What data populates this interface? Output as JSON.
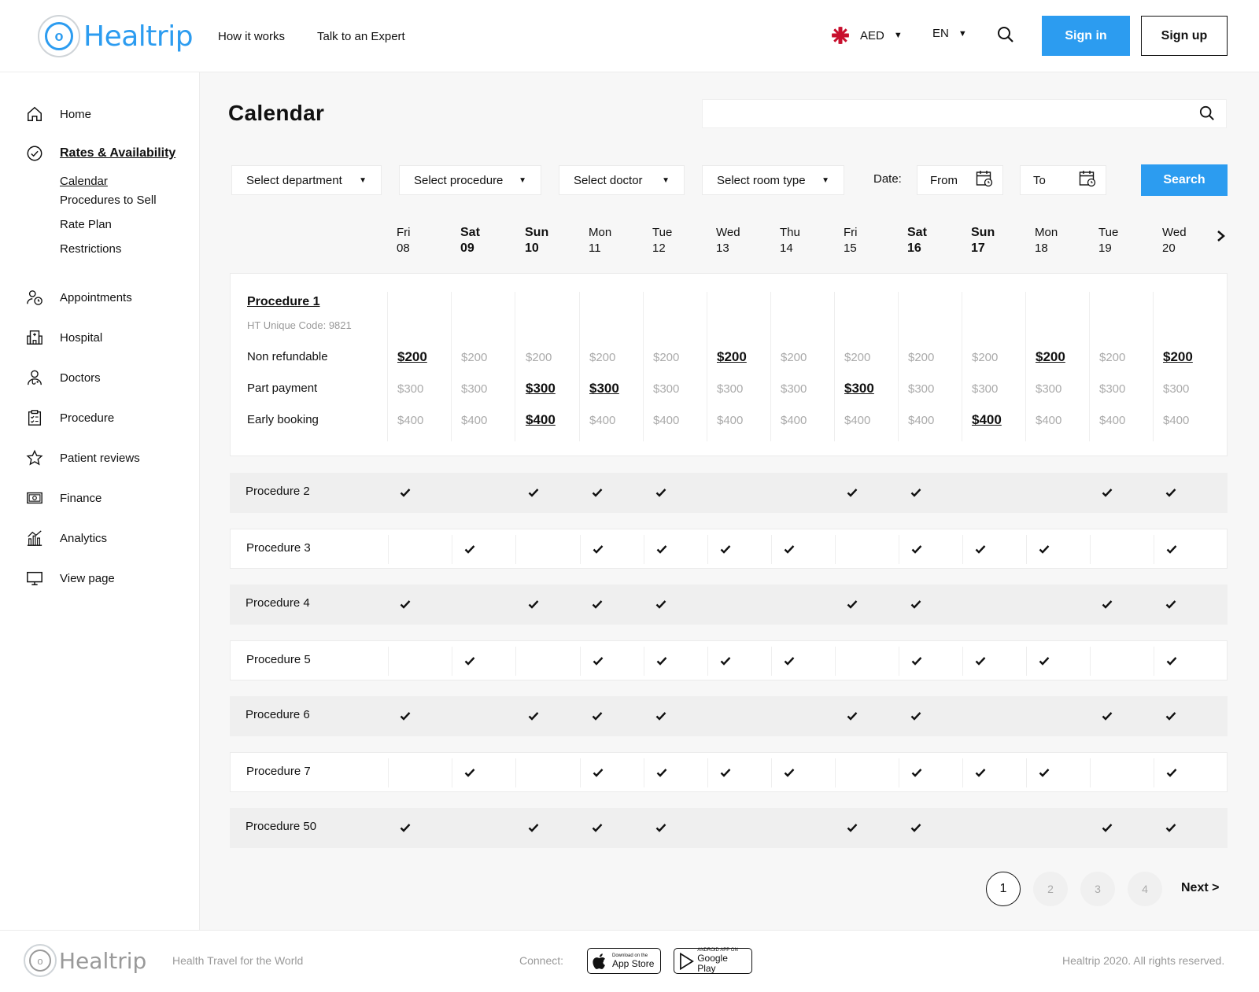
{
  "header": {
    "logo_text": "Healtrip",
    "nav": [
      "How it works",
      "Talk to an Expert"
    ],
    "currency": "AED",
    "language": "EN",
    "sign_in": "Sign in",
    "sign_up": "Sign up"
  },
  "sidebar": {
    "items": [
      {
        "label": "Home",
        "icon": "home-icon"
      },
      {
        "label": "Rates & Availability",
        "icon": "check-circle-icon",
        "active": true
      },
      {
        "label": "Appointments",
        "icon": "user-clock-icon"
      },
      {
        "label": "Hospital",
        "icon": "hospital-icon"
      },
      {
        "label": "Doctors",
        "icon": "doctor-icon"
      },
      {
        "label": "Procedure",
        "icon": "clipboard-icon"
      },
      {
        "label": "Patient reviews",
        "icon": "star-icon"
      },
      {
        "label": "Finance",
        "icon": "money-icon"
      },
      {
        "label": "Analytics",
        "icon": "analytics-icon"
      },
      {
        "label": "View page",
        "icon": "monitor-icon"
      }
    ],
    "subitems": [
      "Calendar",
      "Procedures to Sell",
      "Rate Plan",
      "Restrictions"
    ]
  },
  "main": {
    "title": "Calendar",
    "search_placeholder": "",
    "filters": [
      "Select department",
      "Select procedure",
      "Select doctor",
      "Select room type"
    ],
    "date_label": "Date:",
    "date_from": "From",
    "date_to": "To",
    "search_button": "Search"
  },
  "days": [
    {
      "dow": "Fri",
      "date": "08",
      "weekend": false
    },
    {
      "dow": "Sat",
      "date": "09",
      "weekend": true
    },
    {
      "dow": "Sun",
      "date": "10",
      "weekend": true
    },
    {
      "dow": "Mon",
      "date": "11",
      "weekend": false
    },
    {
      "dow": "Tue",
      "date": "12",
      "weekend": false
    },
    {
      "dow": "Wed",
      "date": "13",
      "weekend": false
    },
    {
      "dow": "Thu",
      "date": "14",
      "weekend": false
    },
    {
      "dow": "Fri",
      "date": "15",
      "weekend": false
    },
    {
      "dow": "Sat",
      "date": "16",
      "weekend": true
    },
    {
      "dow": "Sun",
      "date": "17",
      "weekend": true
    },
    {
      "dow": "Mon",
      "date": "18",
      "weekend": false
    },
    {
      "dow": "Tue",
      "date": "19",
      "weekend": false
    },
    {
      "dow": "Wed",
      "date": "20",
      "weekend": false
    }
  ],
  "procedure1": {
    "title": "Procedure 1",
    "code": "HT Unique Code: 9821",
    "rates": [
      {
        "label": "Non refundable",
        "price": "$200",
        "highlight": [
          0,
          5,
          10,
          12
        ]
      },
      {
        "label": "Part payment",
        "price": "$300",
        "highlight": [
          2,
          3,
          7
        ]
      },
      {
        "label": "Early booking",
        "price": "$400",
        "highlight": [
          2,
          9
        ]
      }
    ]
  },
  "procedures": [
    {
      "name": "Procedure 2",
      "style": "gray",
      "checks": [
        1,
        0,
        1,
        1,
        1,
        0,
        0,
        1,
        1,
        0,
        0,
        1,
        1
      ]
    },
    {
      "name": "Procedure 3",
      "style": "white",
      "checks": [
        0,
        1,
        0,
        1,
        1,
        1,
        1,
        0,
        1,
        1,
        1,
        0,
        1
      ]
    },
    {
      "name": "Procedure 4",
      "style": "gray",
      "checks": [
        1,
        0,
        1,
        1,
        1,
        0,
        0,
        1,
        1,
        0,
        0,
        1,
        1
      ]
    },
    {
      "name": "Procedure 5",
      "style": "white",
      "checks": [
        0,
        1,
        0,
        1,
        1,
        1,
        1,
        0,
        1,
        1,
        1,
        0,
        1
      ]
    },
    {
      "name": "Procedure 6",
      "style": "gray",
      "checks": [
        1,
        0,
        1,
        1,
        1,
        0,
        0,
        1,
        1,
        0,
        0,
        1,
        1
      ]
    },
    {
      "name": "Procedure 7",
      "style": "white",
      "checks": [
        0,
        1,
        0,
        1,
        1,
        1,
        1,
        0,
        1,
        1,
        1,
        0,
        1
      ]
    },
    {
      "name": "Procedure 50",
      "style": "gray",
      "checks": [
        1,
        0,
        1,
        1,
        1,
        0,
        0,
        1,
        1,
        0,
        0,
        1,
        1
      ]
    }
  ],
  "pagination": {
    "pages": [
      "1",
      "2",
      "3",
      "4"
    ],
    "current": "1",
    "next": "Next >"
  },
  "footer": {
    "logo_text": "Healtrip",
    "tagline": "Health Travel for the World",
    "connect": "Connect:",
    "appstore_small": "Download on the",
    "appstore_big": "App Store",
    "googleplay_small": "ANDROID APP ON",
    "googleplay_big": "Google Play",
    "copyright": "Healtrip 2020. All rights reserved."
  },
  "colors": {
    "accent": "#2c9cf0"
  }
}
